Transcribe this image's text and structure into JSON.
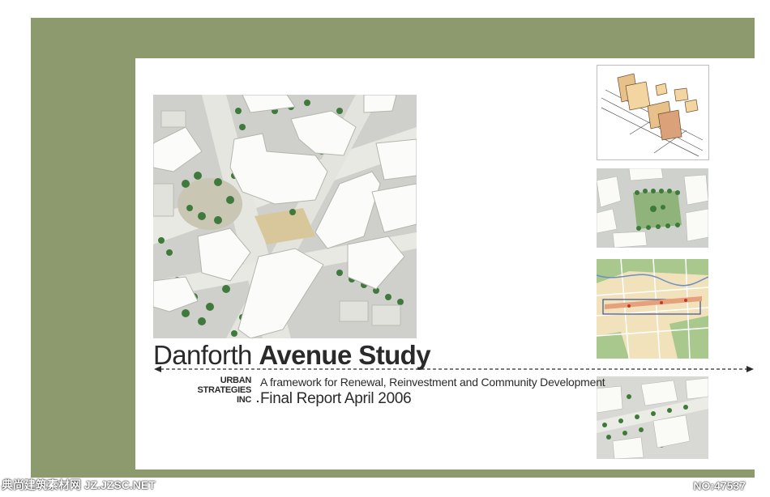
{
  "cover": {
    "title_regular": "Danforth ",
    "title_bold": "Avenue Study",
    "subtitle": "A framework for Renewal, Reinvestment and Community Development",
    "report_line": "Final Report April 2006"
  },
  "logo": {
    "line1": "URBAN",
    "line2": "STRATEGIES",
    "line3": "INC",
    "dot": "."
  },
  "watermark": {
    "left": "典尚建筑素材网 JZ.JZSC.NET",
    "right": "NO:47537"
  },
  "colors": {
    "frame_green": "#8c9a6e",
    "text": "#2a2a2a"
  },
  "images": {
    "main": "architectural-model-aerial-photo",
    "thumbnails": [
      "axonometric-sketch",
      "park-model-photo",
      "neighbourhood-map",
      "street-model-photo"
    ]
  }
}
